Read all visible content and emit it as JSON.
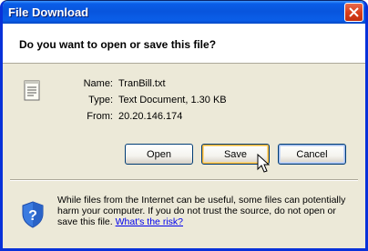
{
  "window": {
    "title": "File Download"
  },
  "header": {
    "question": "Do you want to open or save this file?"
  },
  "file": {
    "icon": "text-document-icon",
    "name_label": "Name:",
    "name_value": "TranBill.txt",
    "type_label": "Type:",
    "type_value": "Text Document, 1.30 KB",
    "from_label": "From:",
    "from_value": "20.20.146.174"
  },
  "buttons": {
    "open": "Open",
    "save": "Save",
    "cancel": "Cancel"
  },
  "warning": {
    "icon": "shield-question-icon",
    "text": "While files from the Internet can be useful, some files can potentially harm your computer. If you do not trust the source, do not open or save this file.",
    "link": "What's the risk?"
  },
  "colors": {
    "titlebar": "#0855dd",
    "dialog_bg": "#ece9d8",
    "close": "#d9401c",
    "link": "#0000ee"
  }
}
